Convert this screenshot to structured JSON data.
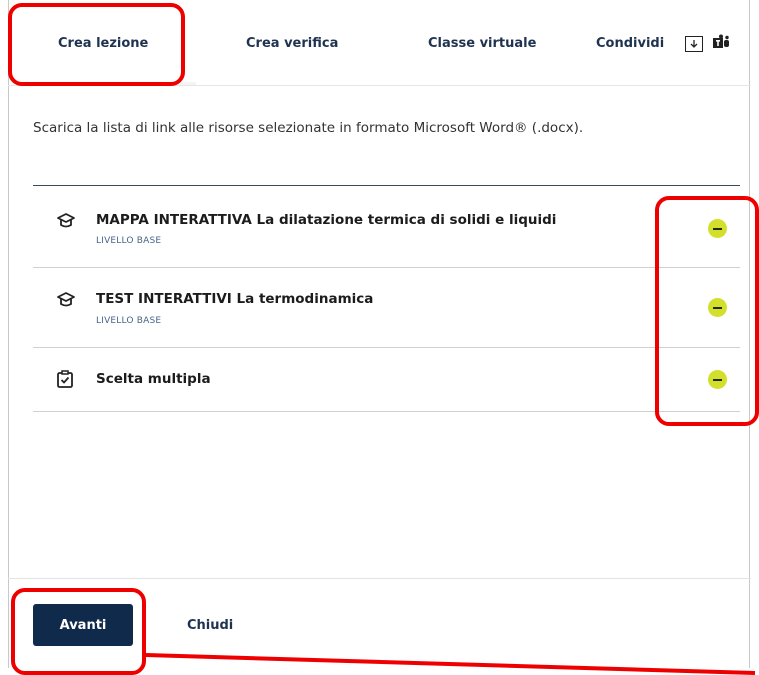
{
  "tabs": [
    {
      "label": "Crea lezione"
    },
    {
      "label": "Crea verifica"
    },
    {
      "label": "Classe virtuale"
    },
    {
      "label": "Condividi"
    }
  ],
  "icons": {
    "download": "download-icon",
    "teams": "teams-icon"
  },
  "description": "Scarica la lista di link alle risorse selezionate in formato Microsoft Word® (.docx).",
  "resources": [
    {
      "title": "MAPPA INTERATTIVA La dilatazione termica di solidi e liquidi",
      "level": "LIVELLO BASE",
      "icon": "graduation-cap-icon"
    },
    {
      "title": "TEST INTERATTIVI La termodinamica",
      "level": "LIVELLO BASE",
      "icon": "graduation-cap-icon"
    },
    {
      "title": "Scelta multipla",
      "level": "",
      "icon": "clipboard-check-icon"
    }
  ],
  "footer": {
    "next_label": "Avanti",
    "close_label": "Chiudi"
  },
  "colors": {
    "accent": "#102a4c",
    "remove": "#d3e02b",
    "annotation": "#ee0000"
  }
}
